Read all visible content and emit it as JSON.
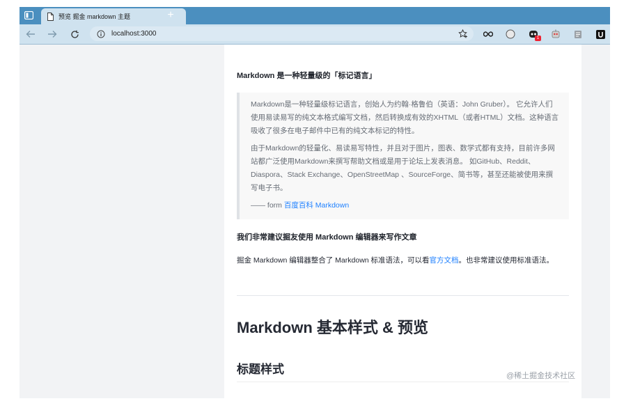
{
  "browser": {
    "tab_title": "预览 掘金 markdown 主题",
    "url": "localhost:3000",
    "new_tab_symbol": "+",
    "tab_close_symbol": "",
    "extension_badge": "1",
    "accent_colors": {
      "tabbar": "#4b8fbf",
      "toolbar": "#cfe2ef",
      "link": "#1e80ff"
    }
  },
  "article": {
    "intro_heading": "Markdown 是一种轻量级的「标记语言」",
    "quote": {
      "p1": "Markdown是一种轻量级标记语言，创始人为约翰·格鲁伯（英语：John Gruber）。 它允许人们使用易读易写的纯文本格式编写文档，然后转换成有效的XHTML（或者HTML）文档。这种语言吸收了很多在电子邮件中已有的纯文本标记的特性。",
      "p2": "由于Markdown的轻量化、易读易写特性，并且对于图片，图表、数学式都有支持，目前许多网站都广泛使用Markdown来撰写帮助文档或是用于论坛上发表消息。 如GitHub、Reddit、Diaspora、Stack Exchange、OpenStreetMap 、SourceForge、简书等，甚至还能被使用来撰写电子书。",
      "source_prefix": "—— form ",
      "source_link": "百度百科 Markdown"
    },
    "recommend_heading": "我们非常建议掘友使用 Markdown 编辑器来写作文章",
    "editor_para_before": "掘金 Markdown 编辑器整合了 Markdown 标准语法，可以看",
    "editor_para_link": "官方文档",
    "editor_para_after": "。也非常建议使用标准语法。",
    "h1": "Markdown 基本样式 & 预览",
    "h2": "标题样式"
  },
  "watermark": "@稀土掘金技术社区"
}
